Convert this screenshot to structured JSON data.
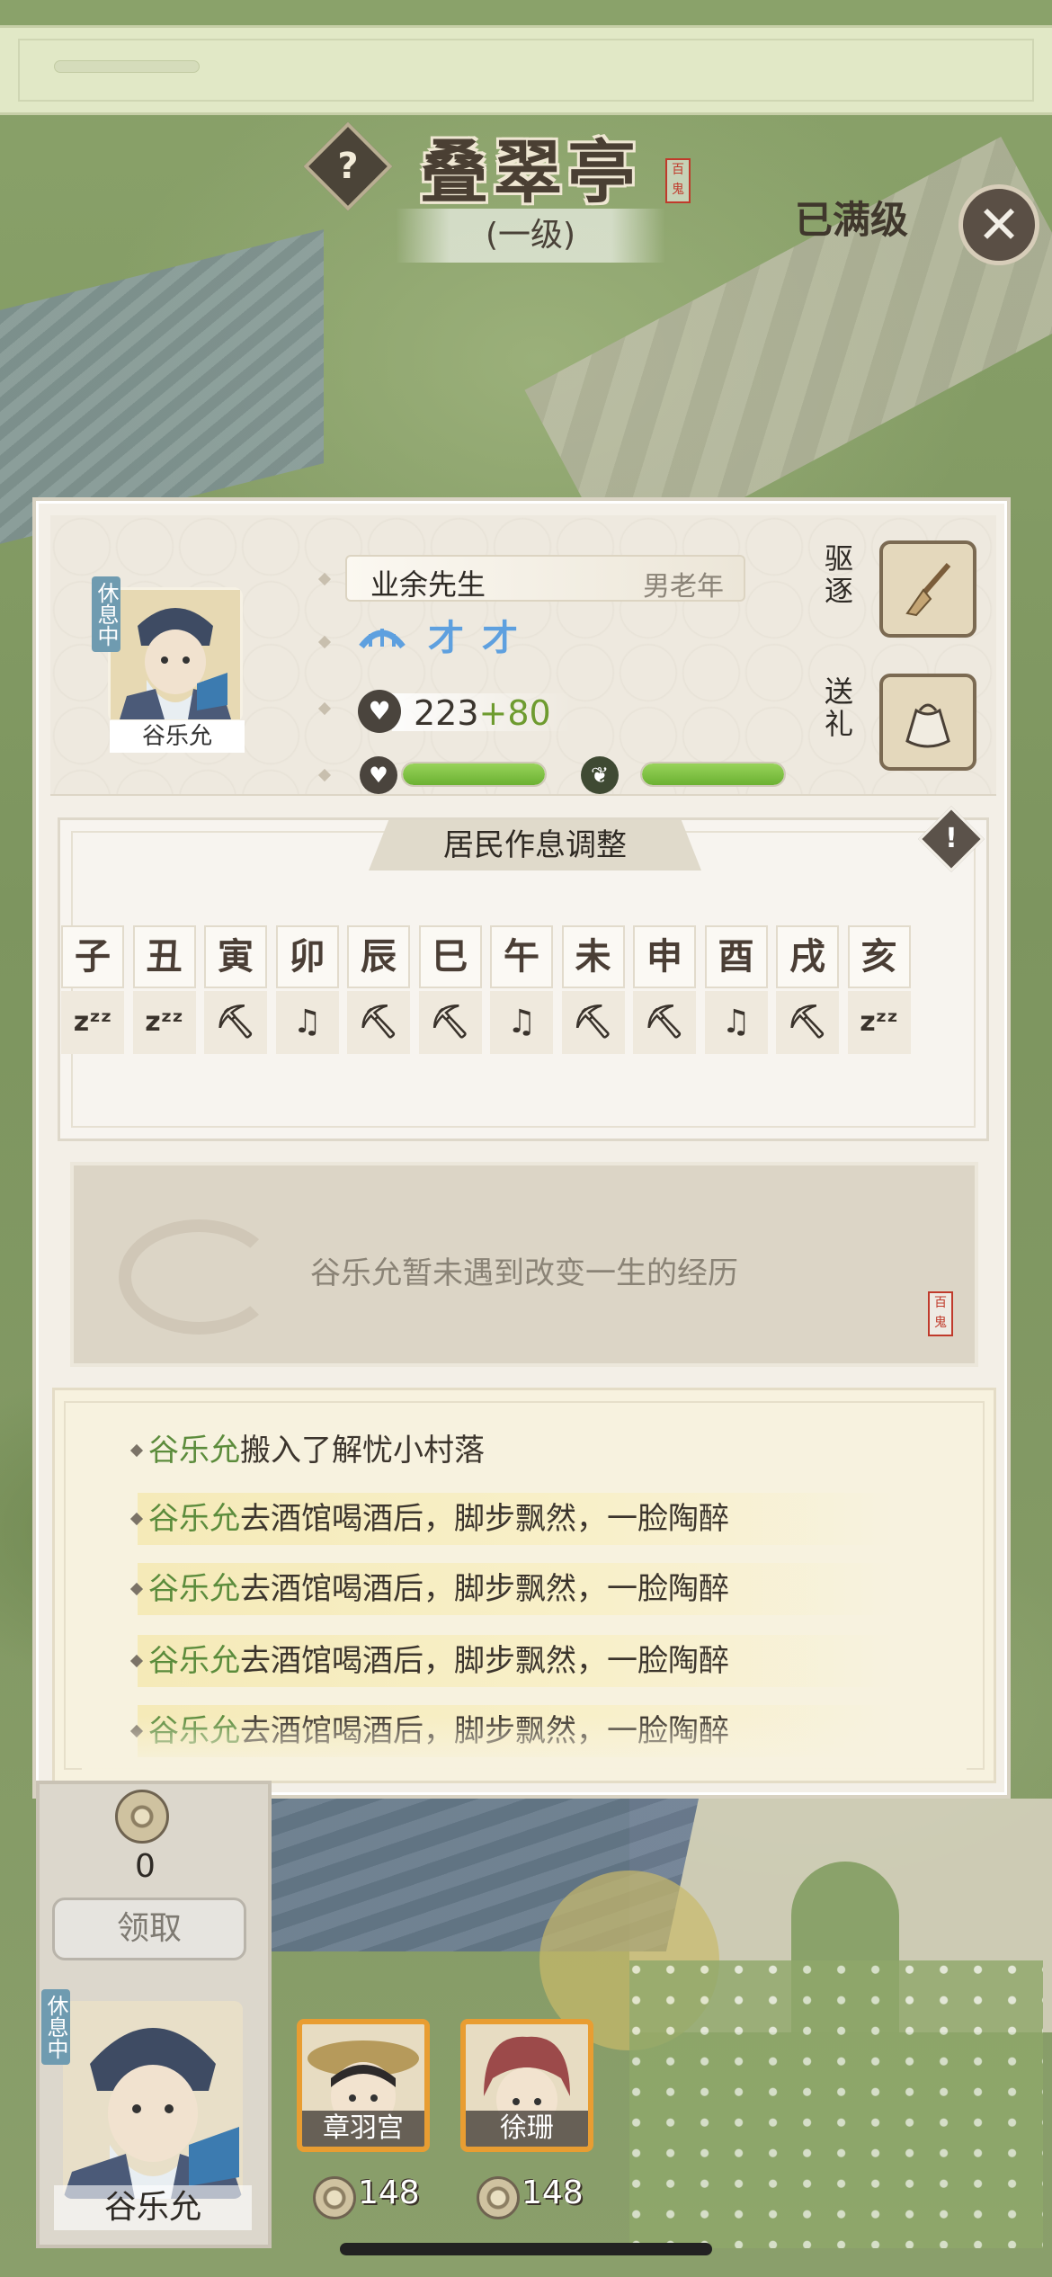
{
  "header": {
    "title": "叠翠亭",
    "level": "(一级)",
    "max_level_label": "已满级",
    "help_icon": "question-mark-icon",
    "close_icon": "close-icon",
    "seal_text": "百鬼"
  },
  "resident": {
    "status_badge": "休息中",
    "name": "谷乐允",
    "title": "业余先生",
    "category": "男老年",
    "power_base": "223",
    "power_bonus": "+80",
    "mood_level": 1.0,
    "health_level": 1.0,
    "actions": {
      "expel_label": "驱逐",
      "gift_label": "送礼"
    }
  },
  "schedule": {
    "title": "居民作息调整",
    "hours": [
      "子",
      "丑",
      "寅",
      "卯",
      "辰",
      "巳",
      "午",
      "未",
      "申",
      "酉",
      "戌",
      "亥"
    ],
    "activities": [
      "sleep",
      "sleep",
      "work",
      "entertain",
      "work",
      "work",
      "entertain",
      "work",
      "work",
      "entertain",
      "work",
      "sleep"
    ]
  },
  "experience": {
    "text": "谷乐允暂未遇到改变一生的经历",
    "seal_text": "百鬼"
  },
  "log": [
    {
      "name": "谷乐允",
      "text": "搬入了解忧小村落",
      "highlight": false
    },
    {
      "name": "谷乐允",
      "text": "去酒馆喝酒后，脚步飘然，一脸陶醉",
      "highlight": true
    },
    {
      "name": "谷乐允",
      "text": "去酒馆喝酒后，脚步飘然，一脸陶醉",
      "highlight": true
    },
    {
      "name": "谷乐允",
      "text": "去酒馆喝酒后，脚步飘然，一脸陶醉",
      "highlight": true
    },
    {
      "name": "谷乐允",
      "text": "去酒馆喝酒后，脚步飘然，一脸陶醉",
      "highlight": true
    }
  ],
  "bottom": {
    "coin_count": "0",
    "claim_label": "领取",
    "current_badge": "休息中",
    "current_name": "谷乐允",
    "candidates": [
      {
        "name": "章羽宫",
        "price": "148"
      },
      {
        "name": "徐珊",
        "price": "148"
      }
    ]
  },
  "colors": {
    "accent_green": "#6bb132",
    "name_green": "#5c8c3c",
    "trait_blue": "#5ea0df",
    "badge_blue": "#6f9bb0",
    "card_orange": "#e89d32"
  }
}
